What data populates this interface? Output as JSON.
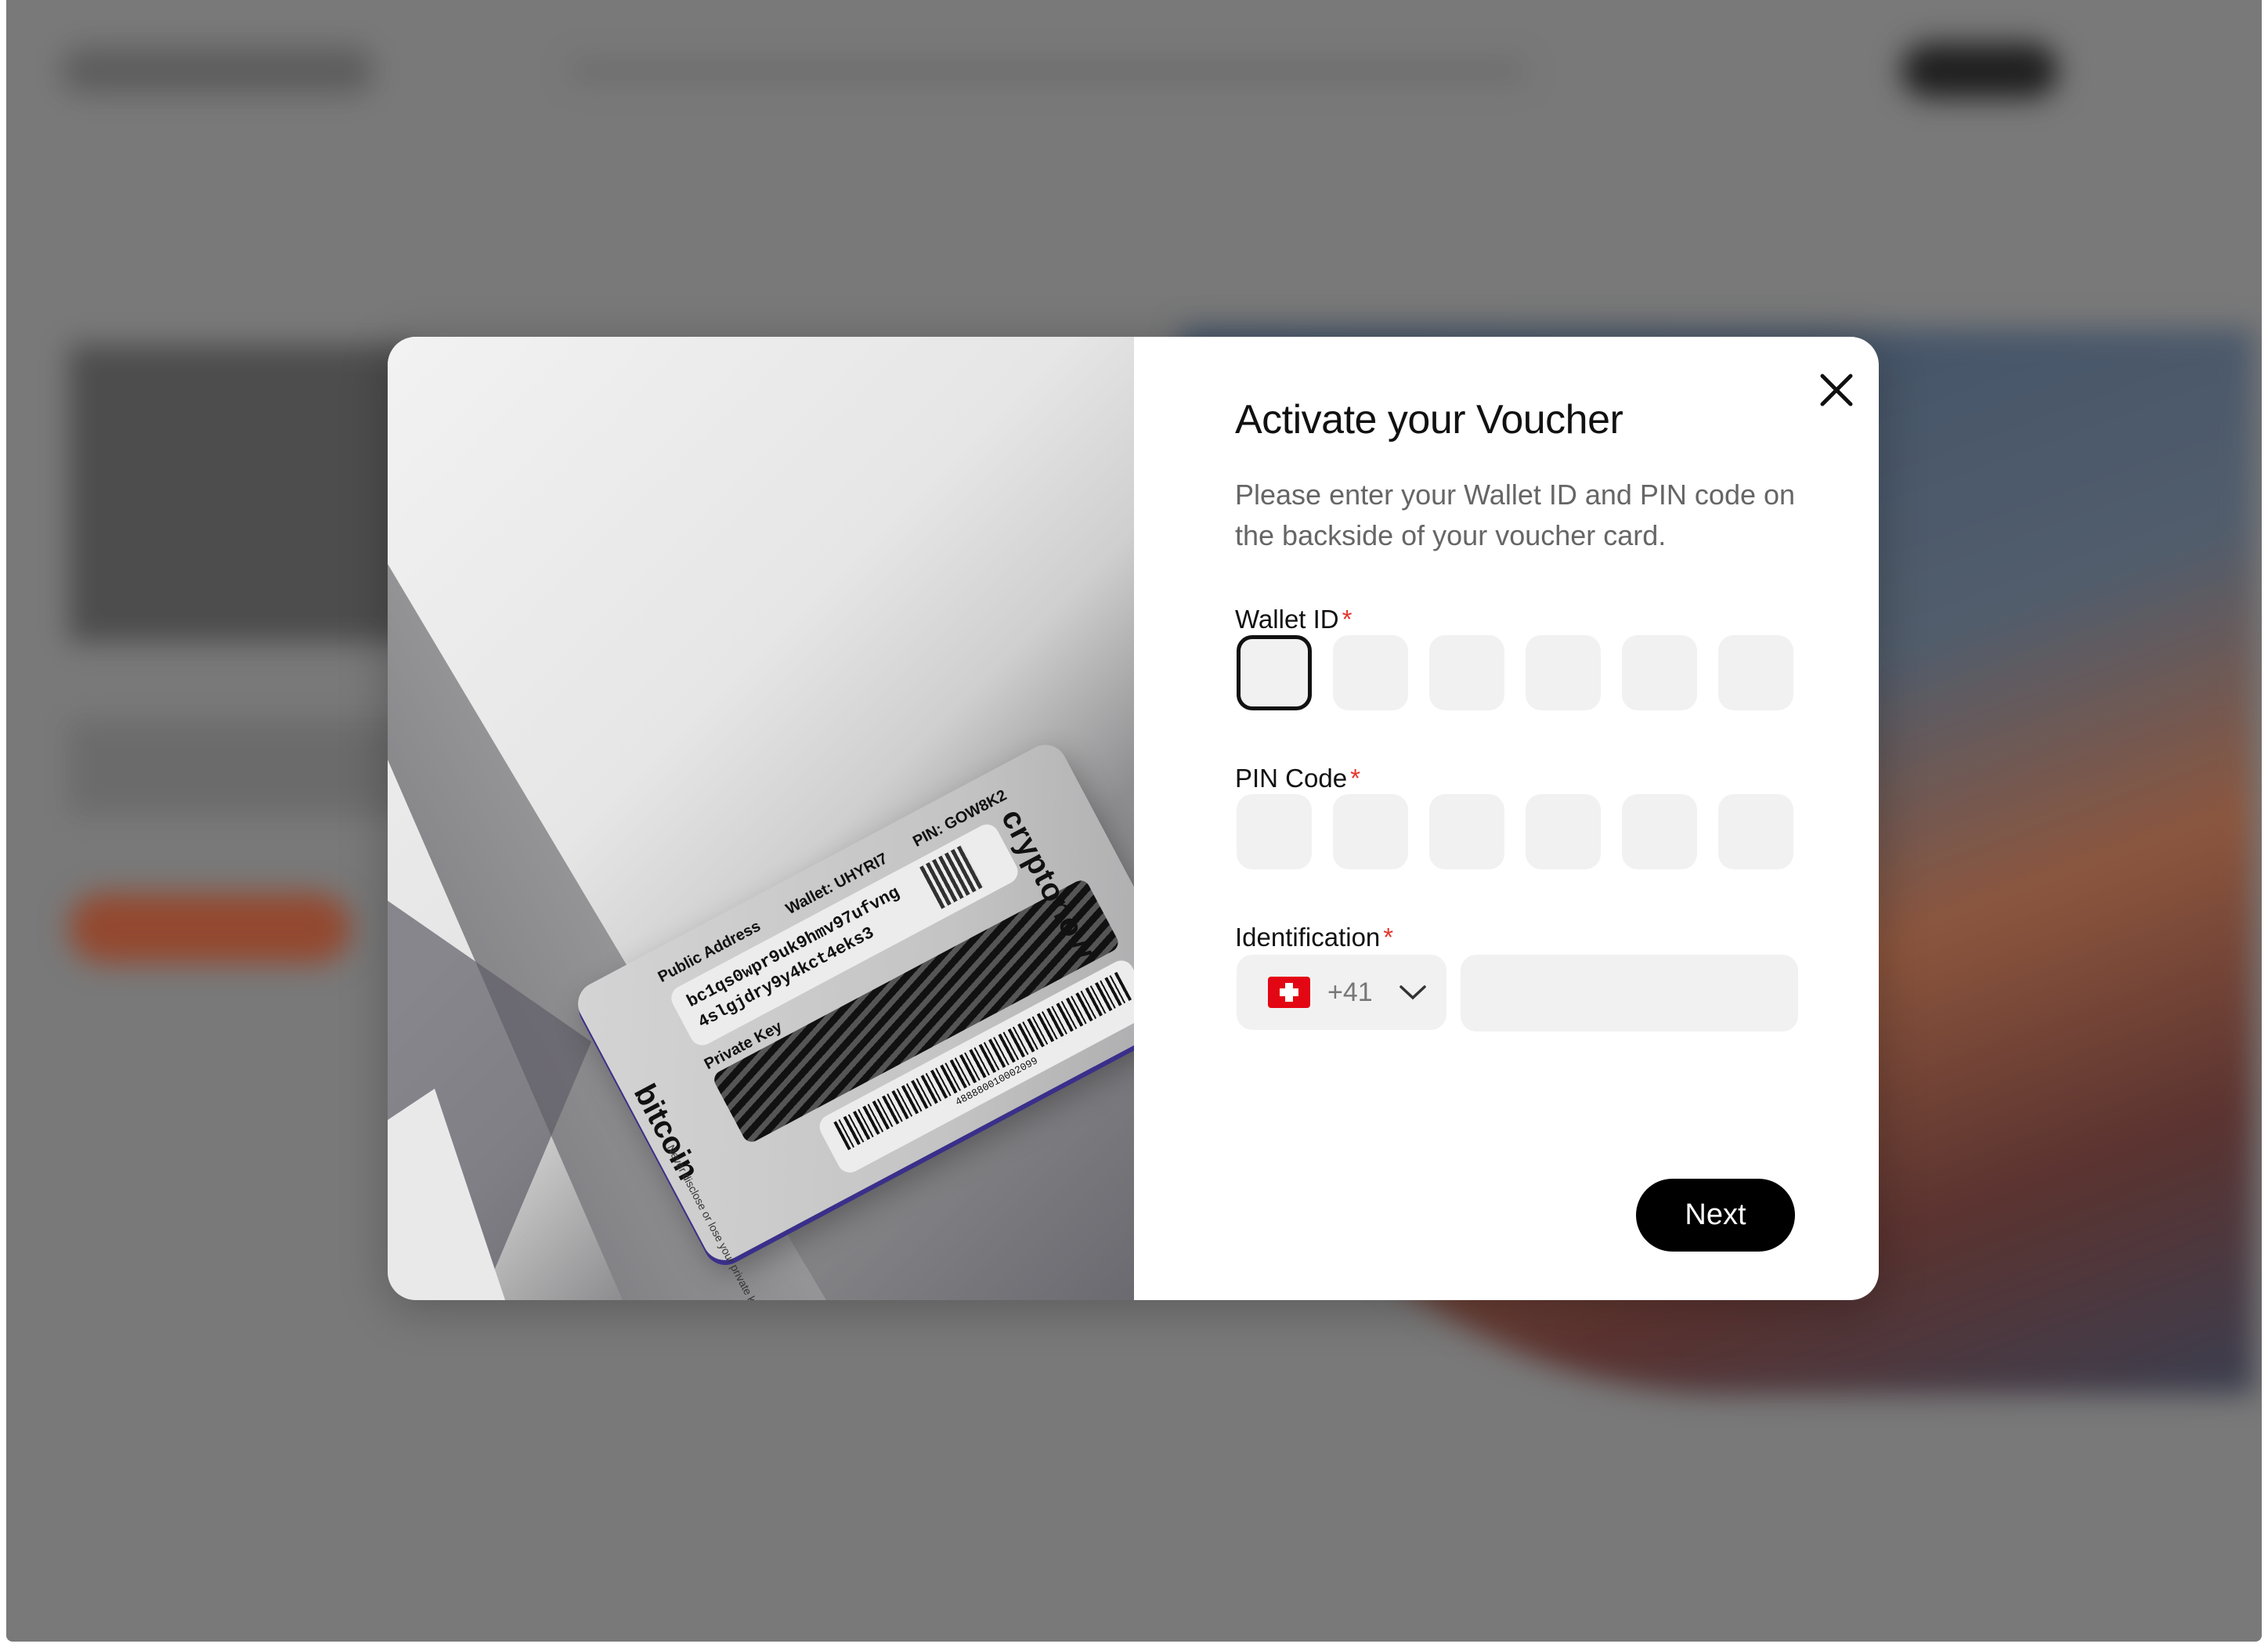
{
  "modal": {
    "title": "Activate your Voucher",
    "subtitle": "Please enter your Wallet ID and PIN code on the backside of your voucher card.",
    "wallet_label": "Wallet ID",
    "pin_label": "PIN Code",
    "identification_label": "Identification",
    "required_mark": "*",
    "country_code": "+41",
    "country_flag": "switzerland-flag",
    "next_label": "Next",
    "close_icon": "close-icon",
    "accent_color": "#e5352b",
    "button_color": "#000000"
  },
  "voucher_card": {
    "brand": "cryptonow",
    "coin": "bitcoin",
    "public_address_label": "Public Address",
    "wallet": "Wallet: UHYRI7",
    "pin": "PIN: GOW8K2",
    "address_line1": "bc1qs0wpr9uk9hmv97ufvng",
    "address_line2": "4slgjdry9y4kct4eks3",
    "private_key_label": "Private Key",
    "barcode_number": "488880010002099",
    "warning": "Never disclose or lose your private key."
  }
}
